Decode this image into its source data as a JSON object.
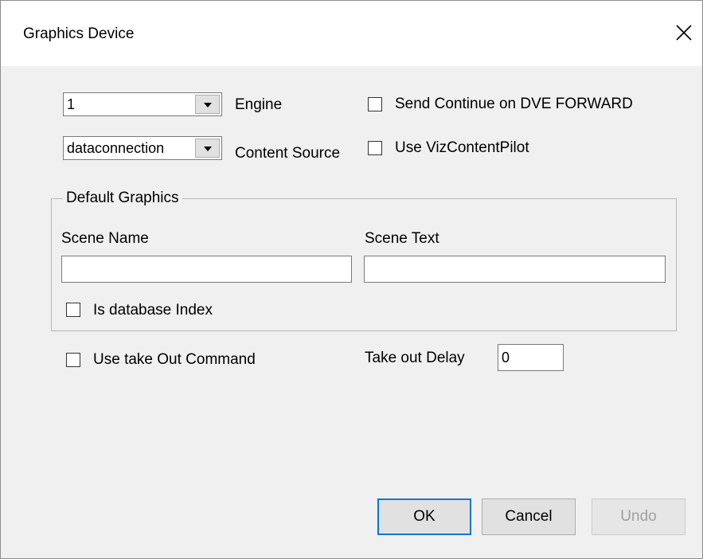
{
  "window": {
    "title": "Graphics Device",
    "close_label": "✕"
  },
  "engine": {
    "value": "1",
    "label": "Engine"
  },
  "content_source": {
    "value": "dataconnection",
    "label": "Content Source"
  },
  "send_continue": {
    "label": "Send Continue on DVE FORWARD",
    "checked": false
  },
  "use_viz": {
    "label": "Use VizContentPilot",
    "checked": false
  },
  "default_graphics": {
    "legend": "Default Graphics",
    "scene_name_label": "Scene Name",
    "scene_name_value": "",
    "scene_text_label": "Scene Text",
    "scene_text_value": "",
    "is_db_index_label": "Is database Index"
  },
  "take_out": {
    "use_cmd_label": "Use take Out Command",
    "delay_label": "Take out Delay",
    "delay_value": "0"
  },
  "buttons": {
    "ok": "OK",
    "cancel": "Cancel",
    "undo": "Undo"
  }
}
